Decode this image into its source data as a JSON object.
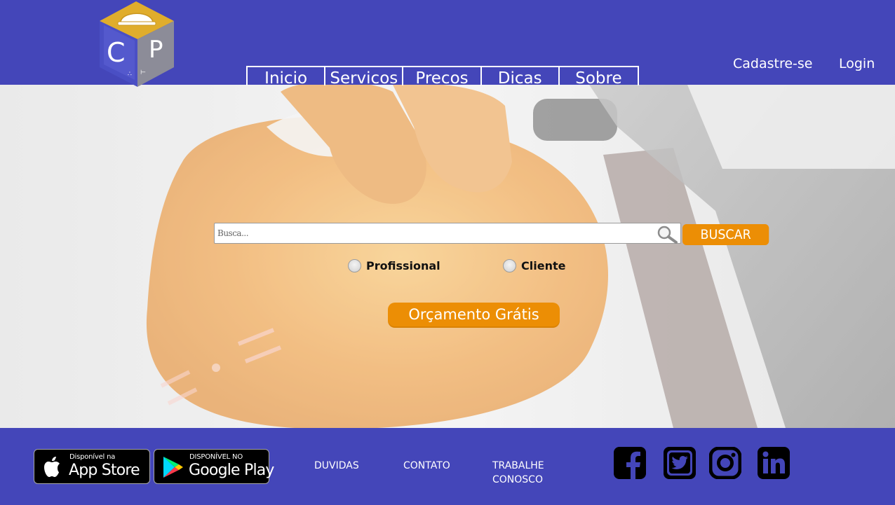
{
  "header": {
    "logo": {
      "letters": [
        "C",
        "P"
      ]
    },
    "nav": [
      {
        "label": "Inicio"
      },
      {
        "label": "Servicos"
      },
      {
        "label": "Precos"
      },
      {
        "label": "Dicas"
      },
      {
        "label": "Sobre"
      }
    ],
    "auth": {
      "signup": "Cadastre-se",
      "login": "Login"
    }
  },
  "search": {
    "placeholder": "Busca...",
    "button_label": "BUSCAR",
    "options": [
      {
        "label": "Profissional",
        "selected": false
      },
      {
        "label": "Cliente",
        "selected": false
      }
    ],
    "quote_button": "Orçamento Grátis"
  },
  "footer": {
    "stores": {
      "apple": {
        "small": "Disponível na",
        "big": "App Store"
      },
      "google": {
        "small": "DISPONÍVEL NO",
        "big": "Google Play"
      }
    },
    "links": {
      "duvidas": "DUVIDAS",
      "contato": "CONTATO",
      "trabalhe_line1": "TRABALHE",
      "trabalhe_line2": "CONOSCO"
    },
    "social": [
      "facebook-icon",
      "twitter-icon",
      "instagram-icon",
      "linkedin-icon"
    ]
  },
  "colors": {
    "brand": "#4446b9",
    "accent": "#ec8e05",
    "text_light": "#ffffff"
  }
}
